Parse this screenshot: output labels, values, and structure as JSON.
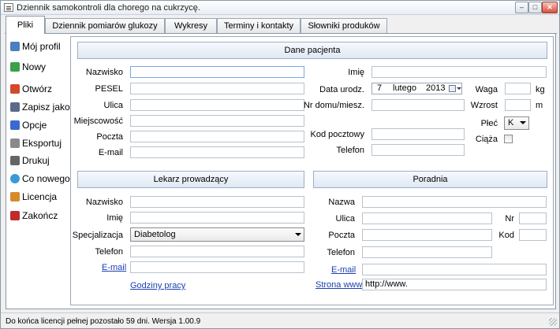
{
  "window": {
    "title": "Dziennik samokontroli dla chorego na cukrzycę.",
    "min_glyph": "–",
    "max_glyph": "□",
    "close_glyph": "✕"
  },
  "tabs": [
    {
      "label": "Pliki"
    },
    {
      "label": "Dziennik pomiarów glukozy"
    },
    {
      "label": "Wykresy"
    },
    {
      "label": "Terminy i kontakty"
    },
    {
      "label": "Słowniki produków"
    }
  ],
  "sidebar": {
    "items": [
      {
        "label": "Mój profil",
        "icon": "profile-icon",
        "color": "#4a7fc0"
      },
      {
        "label": "Nowy",
        "icon": "new-file-icon",
        "color": "#3aa04a"
      },
      {
        "label": "Otwórz",
        "icon": "open-icon",
        "color": "#d24a2a"
      },
      {
        "label": "Zapisz jako",
        "icon": "save-as-icon",
        "color": "#5a6a88"
      },
      {
        "label": "Opcje",
        "icon": "options-icon",
        "color": "#3a6ad0"
      },
      {
        "label": "Eksportuj",
        "icon": "export-icon",
        "color": "#8a8a8a"
      },
      {
        "label": "Drukuj",
        "icon": "print-icon",
        "color": "#666666"
      },
      {
        "label": "Co nowego",
        "icon": "whats-new-icon",
        "color": "#3a9ad8"
      },
      {
        "label": "Licencja",
        "icon": "license-icon",
        "color": "#d88a2a"
      },
      {
        "label": "Zakończ",
        "icon": "exit-icon",
        "color": "#c02a2a"
      }
    ]
  },
  "patient": {
    "section_title": "Dane pacjenta",
    "nazwisko_label": "Nazwisko",
    "pesel_label": "PESEL",
    "ulica_label": "Ulica",
    "miejscowosc_label": "Miejscowość",
    "poczta_label": "Poczta",
    "email_label": "E-mail",
    "imie_label": "Imię",
    "data_label": "Data urodz.",
    "date_day": "7",
    "date_month": "lutego",
    "date_year": "2013",
    "waga_label": "Waga",
    "waga_unit": "kg",
    "nrdomu_label": "Nr domu/miesz.",
    "wzrost_label": "Wzrost",
    "wzrost_unit": "m",
    "plec_label": "Płeć",
    "plec_value": "K",
    "ciaza_label": "Ciąża",
    "kod_label": "Kod pocztowy",
    "telefon_label": "Telefon"
  },
  "doctor": {
    "section_title": "Lekarz prowadzący",
    "nazwisko_label": "Nazwisko",
    "imie_label": "Imię",
    "spec_label": "Specjalizacja",
    "spec_value": "Diabetolog",
    "telefon_label": "Telefon",
    "email_link": "E-mail",
    "hours_link": "Godziny pracy"
  },
  "clinic": {
    "section_title": "Poradnia",
    "nazwa_label": "Nazwa",
    "ulica_label": "Ulica",
    "nr_label": "Nr",
    "poczta_label": "Poczta",
    "kod_label": "Kod",
    "telefon_label": "Telefon",
    "email_link": "E-mail",
    "www_link": "Strona www",
    "www_value": "http://www."
  },
  "status": {
    "text": "Do końca licencji pełnej pozostało 59 dni.  Wersja 1.00.9"
  }
}
